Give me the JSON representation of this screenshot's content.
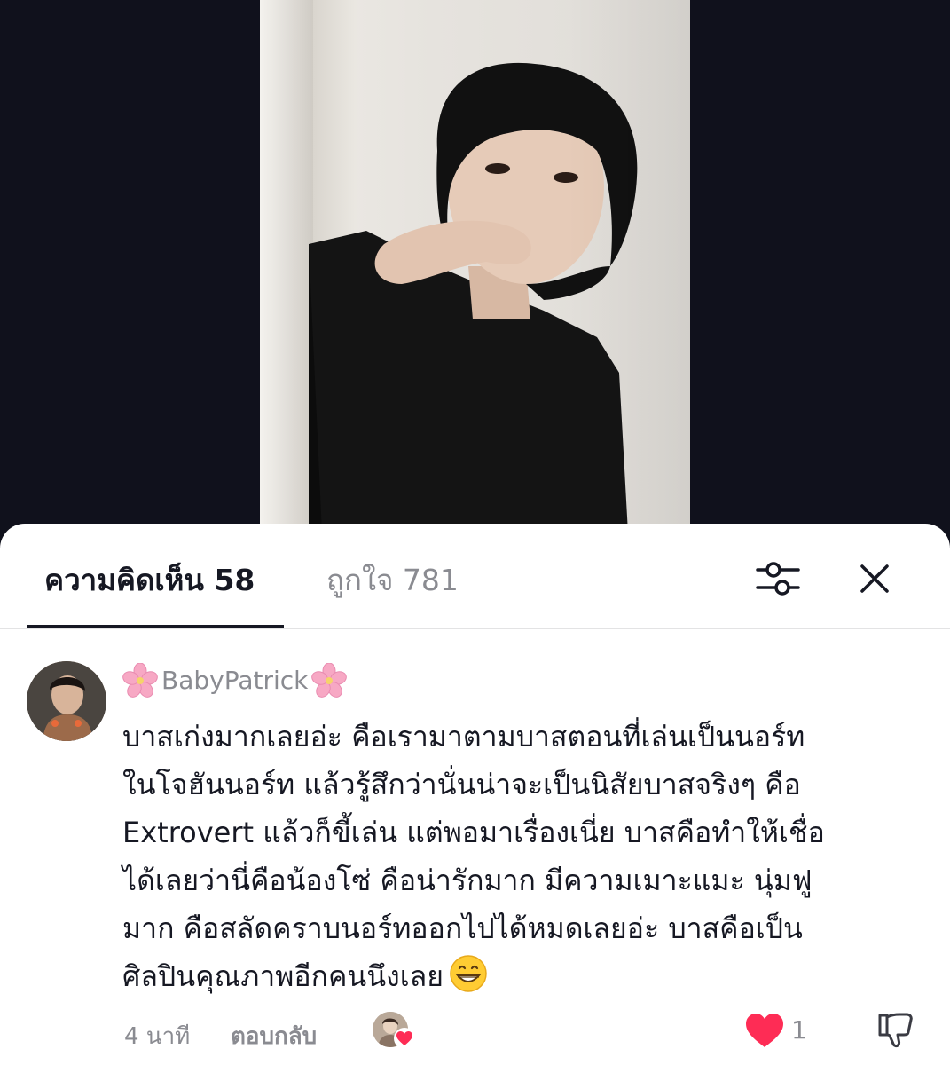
{
  "tabs": {
    "comments_label": "ความคิดเห็น 58",
    "likes_label": "ถูกใจ 781"
  },
  "icons": {
    "filter": "filter-sliders-icon",
    "close": "close-icon",
    "like": "heart-icon",
    "dislike": "thumbs-down-icon",
    "creator_heart": "heart-icon"
  },
  "comment": {
    "username": "BabyPatrick",
    "lines": [
      "บาสเก่งมากเลยอ่ะ คือเรามาตามบาสตอนที่เล่นเป็นนอร์ท",
      "ในโจฮันนอร์ท แล้วรู้สึกว่านั่นน่าจะเป็นนิสัยบาสจริงๆ คือ",
      "Extrovert แล้วก็ขี้เล่น แต่พอมาเรื่องเนี่ย บาสคือทำให้เชื่อ",
      "ได้เลยว่านี่คือน้องโซ่ คือน่ารักมาก มีความเมาะแมะ นุ่มฟู",
      "มาก คือสลัดคราบนอร์ทออกไปได้หมดเลยอ่ะ บาสคือเป็น",
      "ศิลปินคุณภาพอีกคนนึงเลย"
    ],
    "time": "4 นาที",
    "reply_label": "ตอบกลับ",
    "like_count": "1"
  },
  "colors": {
    "like_red": "#fe2c55",
    "text_primary": "#161823",
    "text_secondary": "#8a8b91"
  }
}
